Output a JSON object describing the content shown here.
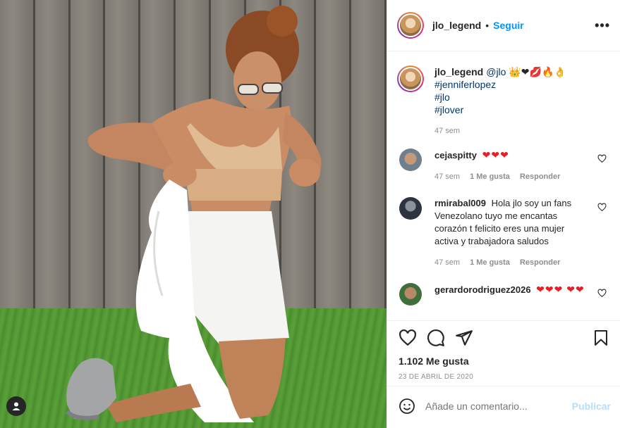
{
  "post": {
    "username": "jlo_legend",
    "follow_label": "Seguir",
    "more_label": "•••"
  },
  "caption": {
    "username": "jlo_legend",
    "mention": "@jlo",
    "emojis": "👑❤💋🔥👌",
    "hashtags": [
      "#jenniferlopez",
      "#jlo",
      "#jlover"
    ],
    "time": "47 sem"
  },
  "comments": [
    {
      "username": "cejaspitty",
      "text": "❤❤❤",
      "time": "47 sem",
      "likes": "1 Me gusta",
      "reply": "Responder"
    },
    {
      "username": "rmirabal009",
      "text": "Hola jlo soy un fans Venezolano tuyo me encantas corazón t felicito eres una mujer activa y trabajadora saludos",
      "time": "47 sem",
      "likes": "1 Me gusta",
      "reply": "Responder"
    },
    {
      "username": "gerardorodriguez2026",
      "text": "❤❤❤ ❤❤"
    }
  ],
  "footer": {
    "likes": "1.102 Me gusta",
    "date": "23 DE ABRIL DE 2020",
    "comment_placeholder": "Añade un comentario...",
    "publish_label": "Publicar"
  },
  "colors": {
    "link": "#0095f6",
    "hashtag": "#00376b",
    "heart": "#ed1c24"
  }
}
